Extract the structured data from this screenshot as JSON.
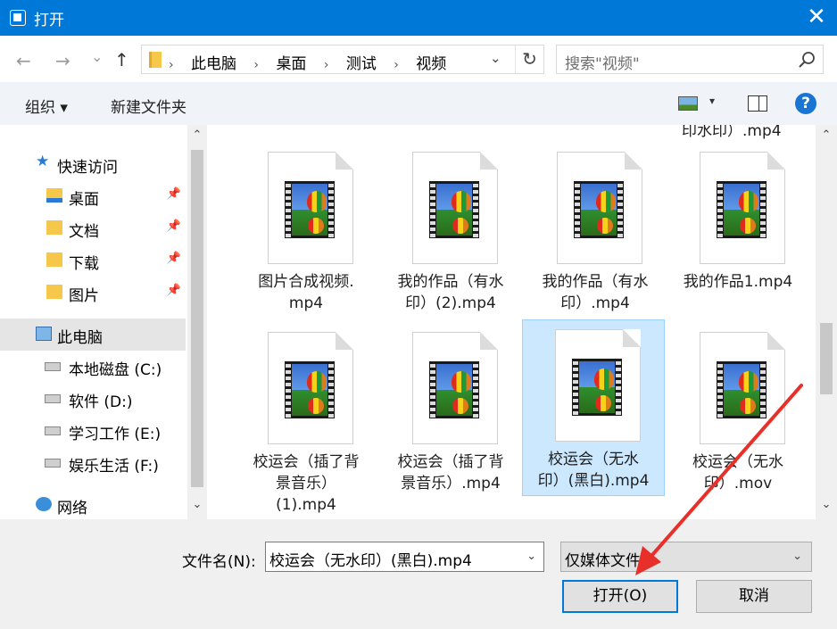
{
  "window": {
    "title": "打开",
    "close_glyph": "✕"
  },
  "nav": {
    "back": "←",
    "forward": "→",
    "recent": "⌄",
    "up": "↑"
  },
  "address": {
    "crumbs": [
      "此电脑",
      "桌面",
      "测试",
      "视频"
    ],
    "sep": "›",
    "dropdown": "⌄",
    "refresh": "↻"
  },
  "search": {
    "placeholder": "搜索\"视频\""
  },
  "toolbar": {
    "organize": "组织 ▾",
    "new_folder": "新建文件夹",
    "view_dd": "▾",
    "help": "?"
  },
  "sidebar": {
    "items": [
      {
        "label": "快速访问",
        "icon": "star-icon"
      },
      {
        "label": "桌面",
        "icon": "desktop-folder-icon"
      },
      {
        "label": "文档",
        "icon": "documents-folder-icon"
      },
      {
        "label": "下载",
        "icon": "downloads-folder-icon"
      },
      {
        "label": "图片",
        "icon": "pictures-folder-icon"
      },
      {
        "label": "此电脑",
        "icon": "computer-icon"
      },
      {
        "label": "本地磁盘 (C:)",
        "icon": "drive-icon"
      },
      {
        "label": "软件 (D:)",
        "icon": "drive-icon"
      },
      {
        "label": "学习工作 (E:)",
        "icon": "drive-icon"
      },
      {
        "label": "娱乐生活 (F:)",
        "icon": "drive-icon"
      },
      {
        "label": "网络",
        "icon": "network-icon"
      }
    ],
    "pin_glyph": "📌"
  },
  "files": {
    "clipped_top": "印水印）.mp4",
    "items": [
      {
        "line1": "图片合成视频.",
        "line2": "mp4",
        "line3": ""
      },
      {
        "line1": "我的作品（有水",
        "line2": "印）(2).mp4",
        "line3": ""
      },
      {
        "line1": "我的作品（有水",
        "line2": "印）.mp4",
        "line3": ""
      },
      {
        "line1": "我的作品1.mp4",
        "line2": "",
        "line3": ""
      },
      {
        "line1": "校运会（插了背",
        "line2": "景音乐）",
        "line3": "(1).mp4"
      },
      {
        "line1": "校运会（插了背",
        "line2": "景音乐）.mp4",
        "line3": ""
      },
      {
        "line1": "校运会（无水",
        "line2": "印）(黑白).mp4",
        "line3": ""
      },
      {
        "line1": "校运会（无水",
        "line2": "印）.mov",
        "line3": ""
      }
    ]
  },
  "bottom": {
    "filename_label": "文件名(N):",
    "filename_value": "校运会（无水印）(黑白).mp4",
    "filter_value": "仅媒体文件",
    "open": "打开(O)",
    "cancel": "取消"
  },
  "scroll": {
    "up": "⌃",
    "down": "⌄"
  },
  "accent_color": "#0078d7",
  "arrow_color": "#e8302a"
}
